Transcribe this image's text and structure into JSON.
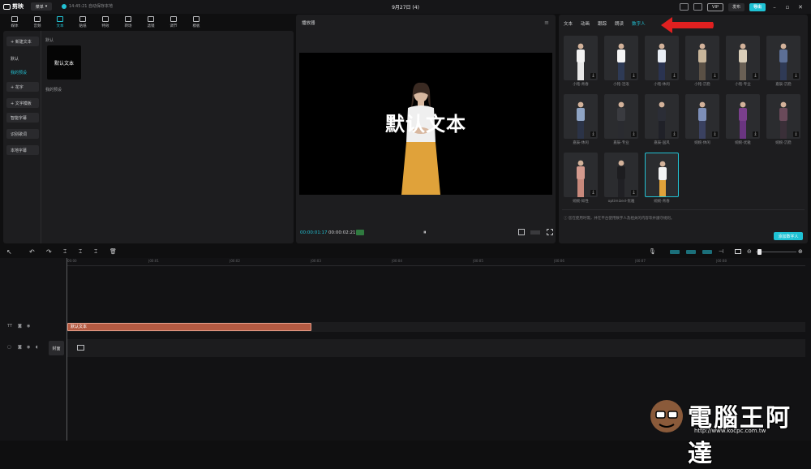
{
  "app": {
    "name": "剪映",
    "menu_label": "菜单",
    "autosave": "14:45:21 自动保存本地",
    "project_title": "9月27日 (4)"
  },
  "topbar": {
    "vip": "VIP",
    "share": "发布",
    "export": "导出"
  },
  "toolbar": {
    "items": [
      "媒体",
      "音频",
      "文本",
      "贴纸",
      "特效",
      "转场",
      "滤镜",
      "调节",
      "模板"
    ],
    "active": 2
  },
  "left_panel": {
    "nav": [
      "+ 新建文本",
      "默认",
      "我的预设",
      "+ 花字",
      "+ 文字模板",
      "智能字幕",
      "识别歌词",
      "本地字幕"
    ],
    "section_default": "默认",
    "template_card": "默认文本",
    "section_preset": "我的预设"
  },
  "player": {
    "title": "播放器",
    "canvas_text": "默认文本",
    "time_current": "00:00:01:17",
    "time_total": "00:00:02:21",
    "play_icon": "⏸"
  },
  "right_panel": {
    "tabs": [
      "文本",
      "动画",
      "跟踪",
      "朗读",
      "数字人"
    ],
    "active_tab": 4,
    "avatars": [
      {
        "label": "小铭-青春",
        "shirt": "#f2f2f2",
        "pants": "#e8e8e8"
      },
      {
        "label": "小铭-活泼",
        "shirt": "#f5f5f5",
        "pants": "#2e3a55"
      },
      {
        "label": "小铭-休闲",
        "shirt": "#e9eef5",
        "pants": "#2a3350"
      },
      {
        "label": "小铭-沉稳",
        "shirt": "#c8b59a",
        "pants": "#5a5045"
      },
      {
        "label": "小铭-专业",
        "shirt": "#d9cdb8",
        "pants": "#6a6055"
      },
      {
        "label": "嘉辰-沉稳",
        "shirt": "#5c6f96",
        "pants": "#2f3a55"
      },
      {
        "label": "嘉辰-休闲",
        "shirt": "#8fa4c4",
        "pants": "#2b3347"
      },
      {
        "label": "嘉辰-专业",
        "shirt": "#3a3b40",
        "pants": "#2a2b30"
      },
      {
        "label": "嘉辰-国风",
        "shirt": "#2b2d36",
        "pants": "#202128"
      },
      {
        "label": "婉婉-休闲",
        "shirt": "#7d8fb8",
        "pants": "#3a4160"
      },
      {
        "label": "婉婉-优雅",
        "shirt": "#7a3f8c",
        "pants": "#6a3580"
      },
      {
        "label": "婉婉-沉稳",
        "shirt": "#6a4a5a",
        "pants": "#3a2f38"
      },
      {
        "label": "婉婉-知性",
        "shirt": "#d49a8e",
        "pants": "#c8897c"
      },
      {
        "label": "optimized-优雅",
        "shirt": "#1d1d20",
        "pants": "#202024"
      },
      {
        "label": "婉婉-青春",
        "shirt": "#f3f3f3",
        "pants": "#e0a23a"
      }
    ],
    "notice": "ⓘ 您在使用时需，并在平台使用数字人及相关的内容等并遵守规则。",
    "add_button": "添加数字人"
  },
  "timeline": {
    "ticks": [
      "00:00",
      "|00:01",
      "|00:02",
      "|00:03",
      "|00:04",
      "|00:05",
      "|00:06",
      "|00:07",
      "|00:08"
    ],
    "text_clip": "默认文本",
    "cover_label": "封面"
  },
  "watermark": {
    "text": "電腦王阿達",
    "url": "http://www.kocpc.com.tw"
  },
  "colors": {
    "accent": "#1ec2d4",
    "clip": "#b45a42",
    "arrow": "#e02020"
  }
}
